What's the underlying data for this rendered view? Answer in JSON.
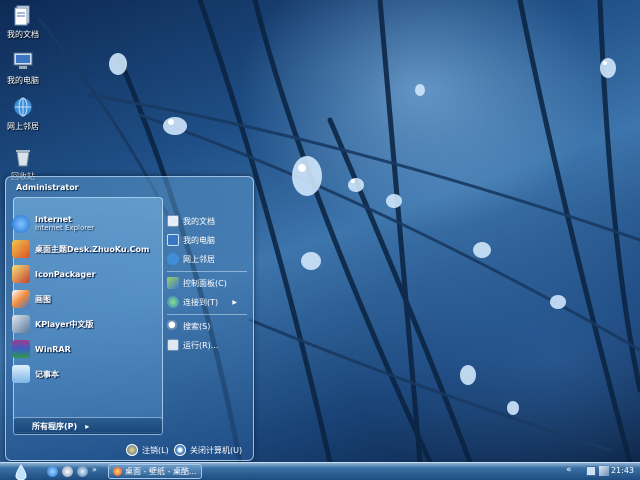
{
  "desktop": {
    "icons": [
      {
        "label": "我的文档",
        "icon": "documents-icon"
      },
      {
        "label": "我的电脑",
        "icon": "computer-icon"
      },
      {
        "label": "网上邻居",
        "icon": "network-icon"
      },
      {
        "label": "回收站",
        "icon": "recycle-bin-icon"
      }
    ]
  },
  "start_menu": {
    "user": "Administrator",
    "programs": [
      {
        "title": "Internet",
        "subtitle": "Internet Explorer",
        "icon": "ie-icon"
      },
      {
        "title": "桌面主题Desk.ZhuoKu.Com",
        "icon": "theme-icon"
      },
      {
        "title": "IconPackager",
        "icon": "iconpackager-icon"
      },
      {
        "title": "画图",
        "icon": "paint-icon"
      },
      {
        "title": "KPlayer中文版",
        "icon": "player-icon"
      },
      {
        "title": "WinRAR",
        "icon": "winrar-icon"
      },
      {
        "title": "记事本",
        "icon": "notepad-icon"
      }
    ],
    "all_programs": "所有程序(P)",
    "right_items": [
      {
        "label": "我的文档",
        "icon": "documents-icon"
      },
      {
        "label": "我的电脑",
        "icon": "computer-icon"
      },
      {
        "label": "网上邻居",
        "icon": "network-icon"
      },
      {
        "label": "控制面板(C)",
        "icon": "control-panel-icon"
      },
      {
        "label": "连接到(T)",
        "icon": "connect-icon"
      },
      {
        "label": "搜索(S)",
        "icon": "search-icon"
      },
      {
        "label": "运行(R)...",
        "icon": "run-icon"
      }
    ],
    "logoff": "注销(L)",
    "shutdown": "关闭计算机(U)"
  },
  "taskbar": {
    "task": "桌面 - 壁纸 - 桌酷...",
    "clock": "21:43"
  },
  "colors": {
    "accent": "#2f6aa8",
    "taskbar": "#1d4c80",
    "menu_border": "#c8e1fa"
  }
}
